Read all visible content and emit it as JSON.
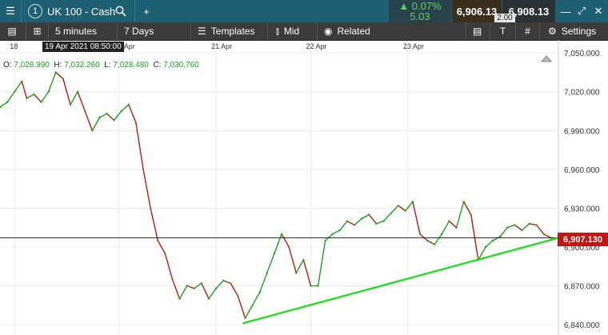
{
  "header": {
    "menu_icon": "hamburger-icon",
    "instrument_number": "1",
    "instrument": "UK 100 - Cash",
    "search_icon": "search-icon",
    "add_icon": "plus-icon",
    "change_pct": "▲ 0.07%",
    "change_abs": "5.03",
    "sell_price": "6,906.13",
    "buy_price": "6,908.13",
    "spread": "2.00"
  },
  "toolbar": {
    "interval": "5 minutes",
    "range": "7 Days",
    "templates": "Templates",
    "price_type": "Mid",
    "related": "Related",
    "settings": "Settings"
  },
  "crosshair": {
    "date_label": "19 Apr 2021 08:50:00",
    "ohlc": {
      "o_label": "O:",
      "o": "7,028.990",
      "h_label": "H:",
      "h": "7,032.260",
      "l_label": "L:",
      "l": "7,028.480",
      "c_label": "C:",
      "c": "7,030.760"
    }
  },
  "chart_data": {
    "type": "line",
    "x_ticks": [
      "18",
      "20 Apr",
      "21 Apr",
      "22 Apr",
      "23 Apr"
    ],
    "y_ticks": [
      6840,
      6870,
      6900,
      6930,
      6960,
      6990,
      7020,
      7050
    ],
    "y_tick_labels": [
      "6,840.000",
      "6,870.000",
      "6,900.000",
      "6,930.000",
      "6,960.000",
      "6,990.000",
      "7,020.000",
      "7,050.000"
    ],
    "ylim": [
      6832,
      7060
    ],
    "current_price": 6907.13,
    "current_price_label": "6,907.130",
    "series": [
      {
        "color_up": "#1aa31a",
        "color_down": "#c41414",
        "points": [
          [
            0.0,
            7008
          ],
          [
            0.3,
            7012
          ],
          [
            0.6,
            7020
          ],
          [
            0.9,
            7028
          ],
          [
            1.1,
            7015
          ],
          [
            1.4,
            7018
          ],
          [
            1.7,
            7012
          ],
          [
            2.0,
            7020
          ],
          [
            2.3,
            7035
          ],
          [
            2.6,
            7030
          ],
          [
            2.9,
            7010
          ],
          [
            3.2,
            7020
          ],
          [
            3.5,
            7005
          ],
          [
            3.8,
            6990
          ],
          [
            4.1,
            7000
          ],
          [
            4.4,
            7003
          ],
          [
            4.7,
            6998
          ],
          [
            5.0,
            7005
          ],
          [
            5.3,
            7010
          ],
          [
            5.6,
            6996
          ],
          [
            5.9,
            6960
          ],
          [
            6.2,
            6930
          ],
          [
            6.5,
            6905
          ],
          [
            6.8,
            6895
          ],
          [
            7.1,
            6875
          ],
          [
            7.4,
            6860
          ],
          [
            7.7,
            6870
          ],
          [
            8.0,
            6868
          ],
          [
            8.3,
            6872
          ],
          [
            8.6,
            6860
          ],
          [
            8.9,
            6868
          ],
          [
            9.2,
            6874
          ],
          [
            9.5,
            6872
          ],
          [
            9.8,
            6862
          ],
          [
            10.1,
            6845
          ],
          [
            10.4,
            6855
          ],
          [
            10.7,
            6865
          ],
          [
            11.0,
            6880
          ],
          [
            11.3,
            6895
          ],
          [
            11.6,
            6910
          ],
          [
            11.9,
            6900
          ],
          [
            12.2,
            6880
          ],
          [
            12.5,
            6890
          ],
          [
            12.8,
            6870
          ],
          [
            13.1,
            6870
          ],
          [
            13.4,
            6905
          ],
          [
            13.7,
            6910
          ],
          [
            14.0,
            6913
          ],
          [
            14.3,
            6920
          ],
          [
            14.6,
            6917
          ],
          [
            14.9,
            6922
          ],
          [
            15.2,
            6925
          ],
          [
            15.5,
            6918
          ],
          [
            15.8,
            6920
          ],
          [
            16.1,
            6926
          ],
          [
            16.4,
            6932
          ],
          [
            16.7,
            6928
          ],
          [
            17.0,
            6935
          ],
          [
            17.3,
            6910
          ],
          [
            17.6,
            6905
          ],
          [
            17.9,
            6902
          ],
          [
            18.2,
            6910
          ],
          [
            18.5,
            6920
          ],
          [
            18.8,
            6915
          ],
          [
            19.1,
            6935
          ],
          [
            19.4,
            6925
          ],
          [
            19.7,
            6890
          ],
          [
            20.0,
            6900
          ],
          [
            20.3,
            6905
          ],
          [
            20.6,
            6908
          ],
          [
            20.9,
            6915
          ],
          [
            21.2,
            6917
          ],
          [
            21.5,
            6913
          ],
          [
            21.8,
            6918
          ],
          [
            22.1,
            6917
          ],
          [
            22.4,
            6910
          ],
          [
            22.7,
            6907
          ]
        ]
      }
    ],
    "trendline": [
      [
        10.0,
        6841
      ],
      [
        23.0,
        6907
      ]
    ],
    "grid": true
  }
}
